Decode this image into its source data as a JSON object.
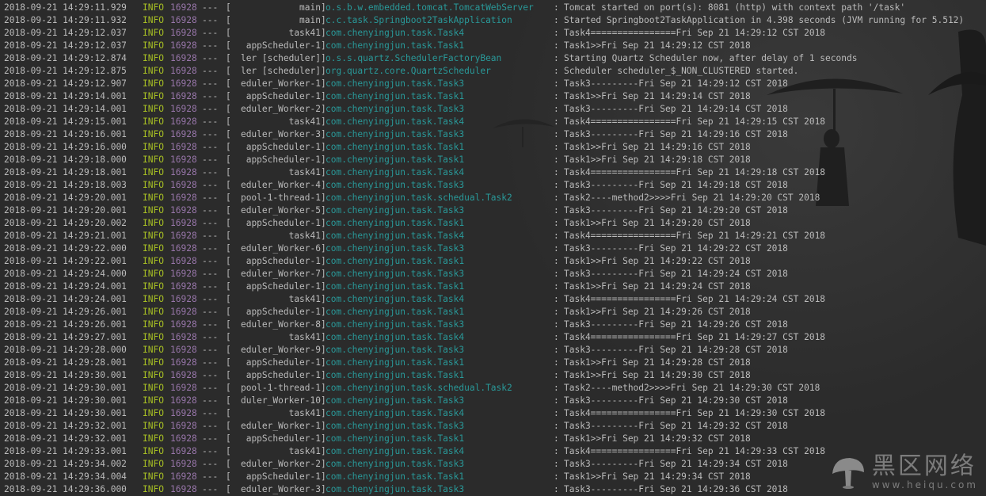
{
  "log_lines": [
    {
      "ts": "2018-09-21 14:29:11.929",
      "level": "INFO",
      "pid": "16928",
      "sep": "---",
      "thread": "main",
      "logger": "o.s.b.w.embedded.tomcat.TomcatWebServer",
      "msg": "Tomcat started on port(s): 8081 (http) with context path '/task'"
    },
    {
      "ts": "2018-09-21 14:29:11.932",
      "level": "INFO",
      "pid": "16928",
      "sep": "---",
      "thread": "main",
      "logger": "c.c.task.Springboot2TaskApplication",
      "msg": "Started Springboot2TaskApplication in 4.398 seconds (JVM running for 5.512)"
    },
    {
      "ts": "2018-09-21 14:29:12.037",
      "level": "INFO",
      "pid": "16928",
      "sep": "---",
      "thread": "task41",
      "logger": "com.chenyingjun.task.Task4",
      "msg": "Task4================Fri Sep 21 14:29:12 CST 2018"
    },
    {
      "ts": "2018-09-21 14:29:12.037",
      "level": "INFO",
      "pid": "16928",
      "sep": "---",
      "thread": "appScheduler-1",
      "logger": "com.chenyingjun.task.Task1",
      "msg": "Task1>>Fri Sep 21 14:29:12 CST 2018"
    },
    {
      "ts": "2018-09-21 14:29:12.874",
      "level": "INFO",
      "pid": "16928",
      "sep": "---",
      "thread": "ler [scheduler]",
      "logger": "o.s.s.quartz.SchedulerFactoryBean",
      "msg": "Starting Quartz Scheduler now, after delay of 1 seconds"
    },
    {
      "ts": "2018-09-21 14:29:12.875",
      "level": "INFO",
      "pid": "16928",
      "sep": "---",
      "thread": "ler [scheduler]",
      "logger": "org.quartz.core.QuartzScheduler",
      "msg": "Scheduler scheduler_$_NON_CLUSTERED started."
    },
    {
      "ts": "2018-09-21 14:29:12.907",
      "level": "INFO",
      "pid": "16928",
      "sep": "---",
      "thread": "eduler_Worker-1",
      "logger": "com.chenyingjun.task.Task3",
      "msg": "Task3---------Fri Sep 21 14:29:12 CST 2018"
    },
    {
      "ts": "2018-09-21 14:29:14.001",
      "level": "INFO",
      "pid": "16928",
      "sep": "---",
      "thread": "appScheduler-1",
      "logger": "com.chenyingjun.task.Task1",
      "msg": "Task1>>Fri Sep 21 14:29:14 CST 2018"
    },
    {
      "ts": "2018-09-21 14:29:14.001",
      "level": "INFO",
      "pid": "16928",
      "sep": "---",
      "thread": "eduler_Worker-2",
      "logger": "com.chenyingjun.task.Task3",
      "msg": "Task3---------Fri Sep 21 14:29:14 CST 2018"
    },
    {
      "ts": "2018-09-21 14:29:15.001",
      "level": "INFO",
      "pid": "16928",
      "sep": "---",
      "thread": "task41",
      "logger": "com.chenyingjun.task.Task4",
      "msg": "Task4================Fri Sep 21 14:29:15 CST 2018"
    },
    {
      "ts": "2018-09-21 14:29:16.001",
      "level": "INFO",
      "pid": "16928",
      "sep": "---",
      "thread": "eduler_Worker-3",
      "logger": "com.chenyingjun.task.Task3",
      "msg": "Task3---------Fri Sep 21 14:29:16 CST 2018"
    },
    {
      "ts": "2018-09-21 14:29:16.000",
      "level": "INFO",
      "pid": "16928",
      "sep": "---",
      "thread": "appScheduler-1",
      "logger": "com.chenyingjun.task.Task1",
      "msg": "Task1>>Fri Sep 21 14:29:16 CST 2018"
    },
    {
      "ts": "2018-09-21 14:29:18.000",
      "level": "INFO",
      "pid": "16928",
      "sep": "---",
      "thread": "appScheduler-1",
      "logger": "com.chenyingjun.task.Task1",
      "msg": "Task1>>Fri Sep 21 14:29:18 CST 2018"
    },
    {
      "ts": "2018-09-21 14:29:18.001",
      "level": "INFO",
      "pid": "16928",
      "sep": "---",
      "thread": "task41",
      "logger": "com.chenyingjun.task.Task4",
      "msg": "Task4================Fri Sep 21 14:29:18 CST 2018"
    },
    {
      "ts": "2018-09-21 14:29:18.003",
      "level": "INFO",
      "pid": "16928",
      "sep": "---",
      "thread": "eduler_Worker-4",
      "logger": "com.chenyingjun.task.Task3",
      "msg": "Task3---------Fri Sep 21 14:29:18 CST 2018"
    },
    {
      "ts": "2018-09-21 14:29:20.001",
      "level": "INFO",
      "pid": "16928",
      "sep": "---",
      "thread": "pool-1-thread-1",
      "logger": "com.chenyingjun.task.schedual.Task2",
      "msg": "Task2----method2>>>>Fri Sep 21 14:29:20 CST 2018"
    },
    {
      "ts": "2018-09-21 14:29:20.001",
      "level": "INFO",
      "pid": "16928",
      "sep": "---",
      "thread": "eduler_Worker-5",
      "logger": "com.chenyingjun.task.Task3",
      "msg": "Task3---------Fri Sep 21 14:29:20 CST 2018"
    },
    {
      "ts": "2018-09-21 14:29:20.002",
      "level": "INFO",
      "pid": "16928",
      "sep": "---",
      "thread": "appScheduler-1",
      "logger": "com.chenyingjun.task.Task1",
      "msg": "Task1>>Fri Sep 21 14:29:20 CST 2018"
    },
    {
      "ts": "2018-09-21 14:29:21.001",
      "level": "INFO",
      "pid": "16928",
      "sep": "---",
      "thread": "task41",
      "logger": "com.chenyingjun.task.Task4",
      "msg": "Task4================Fri Sep 21 14:29:21 CST 2018"
    },
    {
      "ts": "2018-09-21 14:29:22.000",
      "level": "INFO",
      "pid": "16928",
      "sep": "---",
      "thread": "eduler_Worker-6",
      "logger": "com.chenyingjun.task.Task3",
      "msg": "Task3---------Fri Sep 21 14:29:22 CST 2018"
    },
    {
      "ts": "2018-09-21 14:29:22.001",
      "level": "INFO",
      "pid": "16928",
      "sep": "---",
      "thread": "appScheduler-1",
      "logger": "com.chenyingjun.task.Task1",
      "msg": "Task1>>Fri Sep 21 14:29:22 CST 2018"
    },
    {
      "ts": "2018-09-21 14:29:24.000",
      "level": "INFO",
      "pid": "16928",
      "sep": "---",
      "thread": "eduler_Worker-7",
      "logger": "com.chenyingjun.task.Task3",
      "msg": "Task3---------Fri Sep 21 14:29:24 CST 2018"
    },
    {
      "ts": "2018-09-21 14:29:24.001",
      "level": "INFO",
      "pid": "16928",
      "sep": "---",
      "thread": "appScheduler-1",
      "logger": "com.chenyingjun.task.Task1",
      "msg": "Task1>>Fri Sep 21 14:29:24 CST 2018"
    },
    {
      "ts": "2018-09-21 14:29:24.001",
      "level": "INFO",
      "pid": "16928",
      "sep": "---",
      "thread": "task41",
      "logger": "com.chenyingjun.task.Task4",
      "msg": "Task4================Fri Sep 21 14:29:24 CST 2018"
    },
    {
      "ts": "2018-09-21 14:29:26.001",
      "level": "INFO",
      "pid": "16928",
      "sep": "---",
      "thread": "appScheduler-1",
      "logger": "com.chenyingjun.task.Task1",
      "msg": "Task1>>Fri Sep 21 14:29:26 CST 2018"
    },
    {
      "ts": "2018-09-21 14:29:26.001",
      "level": "INFO",
      "pid": "16928",
      "sep": "---",
      "thread": "eduler_Worker-8",
      "logger": "com.chenyingjun.task.Task3",
      "msg": "Task3---------Fri Sep 21 14:29:26 CST 2018"
    },
    {
      "ts": "2018-09-21 14:29:27.001",
      "level": "INFO",
      "pid": "16928",
      "sep": "---",
      "thread": "task41",
      "logger": "com.chenyingjun.task.Task4",
      "msg": "Task4================Fri Sep 21 14:29:27 CST 2018"
    },
    {
      "ts": "2018-09-21 14:29:28.000",
      "level": "INFO",
      "pid": "16928",
      "sep": "---",
      "thread": "eduler_Worker-9",
      "logger": "com.chenyingjun.task.Task3",
      "msg": "Task3---------Fri Sep 21 14:29:28 CST 2018"
    },
    {
      "ts": "2018-09-21 14:29:28.001",
      "level": "INFO",
      "pid": "16928",
      "sep": "---",
      "thread": "appScheduler-1",
      "logger": "com.chenyingjun.task.Task1",
      "msg": "Task1>>Fri Sep 21 14:29:28 CST 2018"
    },
    {
      "ts": "2018-09-21 14:29:30.001",
      "level": "INFO",
      "pid": "16928",
      "sep": "---",
      "thread": "appScheduler-1",
      "logger": "com.chenyingjun.task.Task1",
      "msg": "Task1>>Fri Sep 21 14:29:30 CST 2018"
    },
    {
      "ts": "2018-09-21 14:29:30.001",
      "level": "INFO",
      "pid": "16928",
      "sep": "---",
      "thread": "pool-1-thread-1",
      "logger": "com.chenyingjun.task.schedual.Task2",
      "msg": "Task2----method2>>>>Fri Sep 21 14:29:30 CST 2018"
    },
    {
      "ts": "2018-09-21 14:29:30.001",
      "level": "INFO",
      "pid": "16928",
      "sep": "---",
      "thread": "duler_Worker-10",
      "logger": "com.chenyingjun.task.Task3",
      "msg": "Task3---------Fri Sep 21 14:29:30 CST 2018"
    },
    {
      "ts": "2018-09-21 14:29:30.001",
      "level": "INFO",
      "pid": "16928",
      "sep": "---",
      "thread": "task41",
      "logger": "com.chenyingjun.task.Task4",
      "msg": "Task4================Fri Sep 21 14:29:30 CST 2018"
    },
    {
      "ts": "2018-09-21 14:29:32.001",
      "level": "INFO",
      "pid": "16928",
      "sep": "---",
      "thread": "eduler_Worker-1",
      "logger": "com.chenyingjun.task.Task3",
      "msg": "Task3---------Fri Sep 21 14:29:32 CST 2018"
    },
    {
      "ts": "2018-09-21 14:29:32.001",
      "level": "INFO",
      "pid": "16928",
      "sep": "---",
      "thread": "appScheduler-1",
      "logger": "com.chenyingjun.task.Task1",
      "msg": "Task1>>Fri Sep 21 14:29:32 CST 2018"
    },
    {
      "ts": "2018-09-21 14:29:33.001",
      "level": "INFO",
      "pid": "16928",
      "sep": "---",
      "thread": "task41",
      "logger": "com.chenyingjun.task.Task4",
      "msg": "Task4================Fri Sep 21 14:29:33 CST 2018"
    },
    {
      "ts": "2018-09-21 14:29:34.002",
      "level": "INFO",
      "pid": "16928",
      "sep": "---",
      "thread": "eduler_Worker-2",
      "logger": "com.chenyingjun.task.Task3",
      "msg": "Task3---------Fri Sep 21 14:29:34 CST 2018"
    },
    {
      "ts": "2018-09-21 14:29:34.004",
      "level": "INFO",
      "pid": "16928",
      "sep": "---",
      "thread": "appScheduler-1",
      "logger": "com.chenyingjun.task.Task1",
      "msg": "Task1>>Fri Sep 21 14:29:34 CST 2018"
    },
    {
      "ts": "2018-09-21 14:29:36.000",
      "level": "INFO",
      "pid": "16928",
      "sep": "---",
      "thread": "eduler_Worker-3",
      "logger": "com.chenyingjun.task.Task3",
      "msg": "Task3---------Fri Sep 21 14:29:36 CST 2018"
    }
  ],
  "watermark": {
    "main_text": "黑区网络",
    "sub_text": "www.heiqu.com"
  },
  "colors": {
    "background": "#2b2b2b",
    "text": "#bbbbbb",
    "level": "#a8c023",
    "pid": "#9876aa",
    "logger": "#299999"
  }
}
